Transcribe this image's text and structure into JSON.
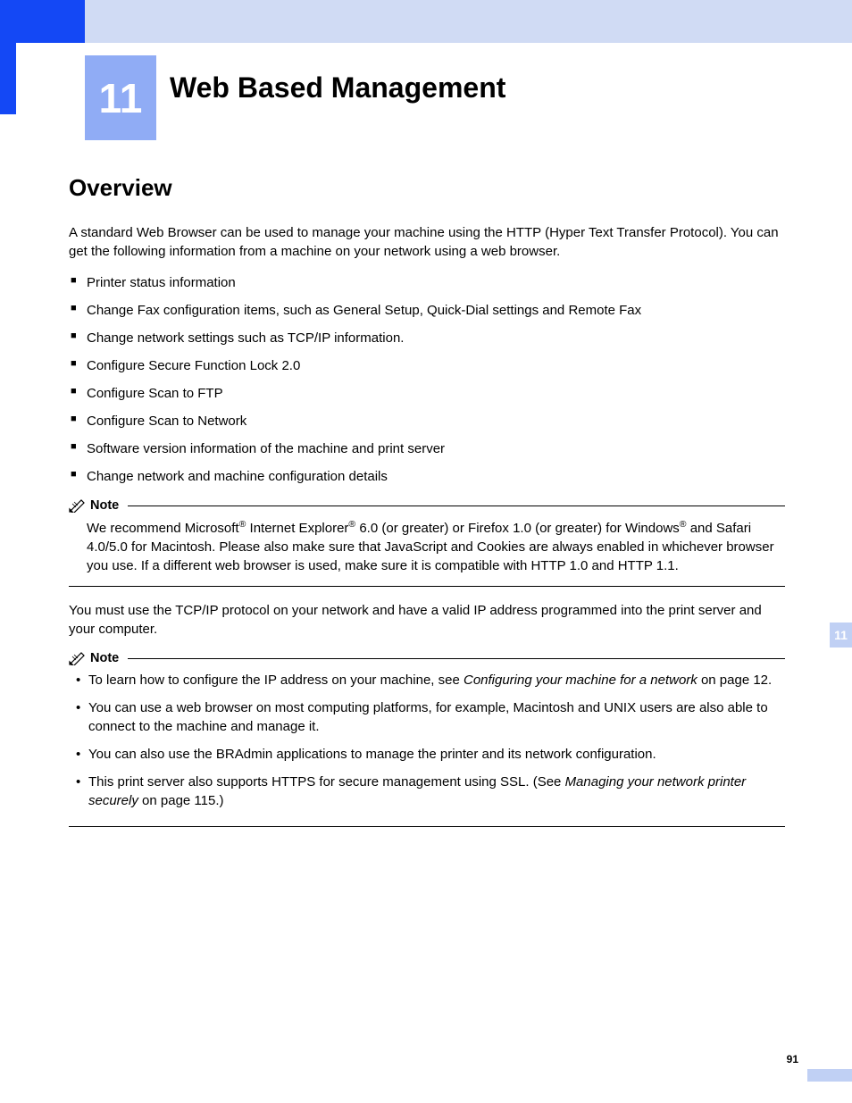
{
  "chapter": {
    "number": "11",
    "title": "Web Based Management"
  },
  "section_heading": "Overview",
  "intro": "A standard Web Browser can be used to manage your machine using the HTTP (Hyper Text Transfer Protocol). You can get the following information from a machine on your network using a web browser.",
  "bullets": [
    "Printer status information",
    "Change Fax configuration items, such as General Setup, Quick-Dial settings and Remote Fax",
    "Change network settings such as TCP/IP information.",
    "Configure Secure Function Lock 2.0",
    "Configure Scan to FTP",
    "Configure Scan to Network",
    "Software version information of the machine and print server",
    "Change network and machine configuration details"
  ],
  "note1": {
    "label": "Note",
    "pre1": "We recommend Microsoft",
    "sup1": "®",
    "mid1": " Internet Explorer",
    "sup2": "®",
    "mid2": " 6.0 (or greater) or Firefox 1.0 (or greater) for Windows",
    "sup3": "®",
    "post": " and Safari 4.0/5.0 for Macintosh. Please also make sure that JavaScript and Cookies are always enabled in whichever browser you use. If a different web browser is used, make sure it is compatible with HTTP 1.0 and HTTP 1.1."
  },
  "para2": "You must use the TCP/IP protocol on your network and have a valid IP address programmed into the print server and your computer.",
  "note2": {
    "label": "Note",
    "items": {
      "i0": {
        "pre": "To learn how to configure the IP address on your machine, see ",
        "link": "Configuring your machine for a network",
        "post": " on page 12."
      },
      "i1": {
        "text": "You can use a web browser on most computing platforms, for example, Macintosh and UNIX users are also able to connect to the machine and manage it."
      },
      "i2": {
        "text": "You can also use the BRAdmin applications to manage the printer and its network configuration."
      },
      "i3": {
        "pre": "This print server also supports HTTPS for secure management using SSL. (See ",
        "link": "Managing your network printer securely",
        "post": " on page 115.)"
      }
    }
  },
  "side_tab": "11",
  "page_number": "91"
}
